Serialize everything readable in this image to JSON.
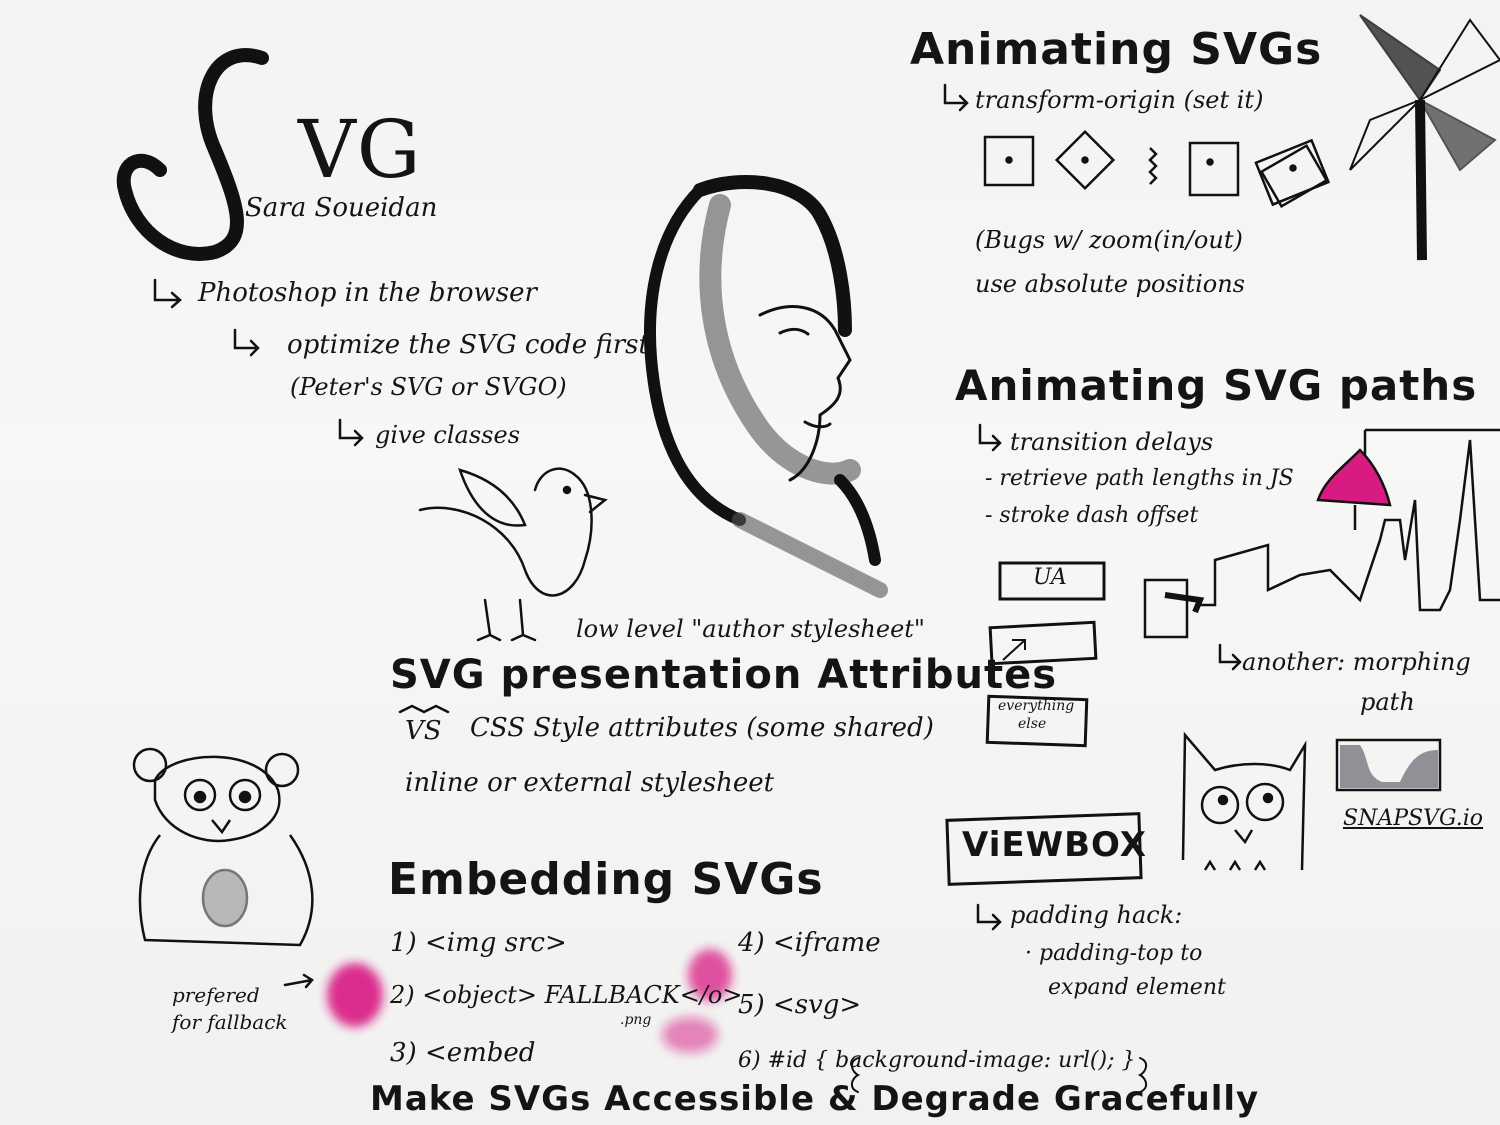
{
  "colors": {
    "ink": "#141414",
    "wash": "#6f6f78",
    "magenta": "#d81b83",
    "paper": "#f4f4f2"
  },
  "title": {
    "letters": "VG",
    "author": "Sara Soueidan"
  },
  "photoshop": {
    "line1": "Photoshop in the browser",
    "line2": "optimize the SVG code first",
    "line3": "(Peter's SVG or SVGO)",
    "line4": "give classes"
  },
  "animating": {
    "heading": "Animating SVGs",
    "sub": "transform-origin (set it)",
    "bugs": "(Bugs w/ zoom(in/out)",
    "use": "use absolute positions"
  },
  "paths": {
    "heading": "Animating SVG paths",
    "sub": "transition delays",
    "bullet1": "- retrieve path lengths in JS",
    "bullet2": "- stroke dash offset",
    "another": "another: morphing",
    "another2": "path"
  },
  "cascade": {
    "box1": "UA",
    "box3_line1": "everything",
    "box3_line2": "else",
    "author_note": "low level \"author stylesheet\""
  },
  "presentation": {
    "heading": "SVG presentation Attributes",
    "vs": "VS",
    "line1": "CSS Style attributes (some shared)",
    "line2": "inline or external stylesheet"
  },
  "viewbox": {
    "label": "ViEWBOX",
    "line1": "padding hack:",
    "line2": "· padding-top to",
    "line3": "expand element"
  },
  "snap": {
    "label": "SNAPSVG.io"
  },
  "embedding": {
    "heading": "Embedding SVGs",
    "item1": "1) <img src>",
    "item2": "2) <object> FALLBACK</o>",
    "item2_sub": ".png",
    "item3": "3) <embed",
    "item4": "4) <iframe",
    "item5": "5) <svg>",
    "item6": "6) #id { background-image: url(); }",
    "preferred1": "prefered",
    "preferred2": "for fallback"
  },
  "footer": {
    "text": "Make SVGs Accessible & Degrade Gracefully"
  }
}
